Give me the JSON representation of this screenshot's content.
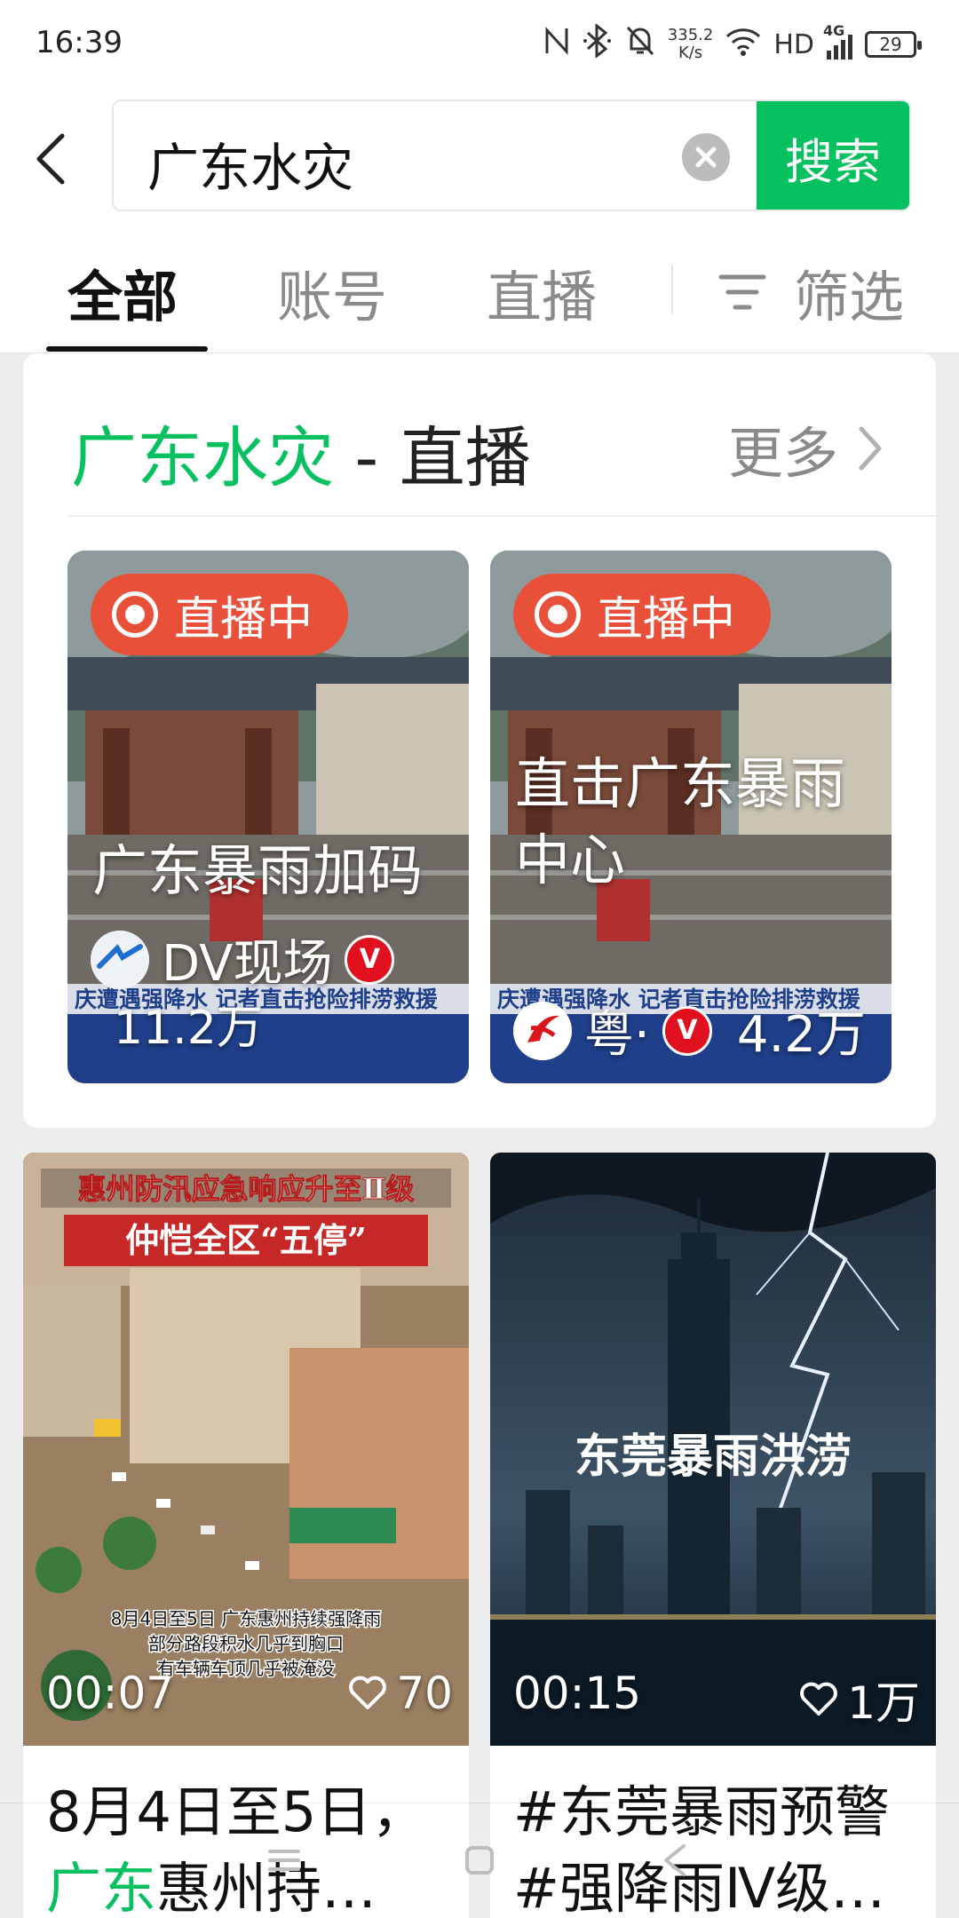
{
  "status_bar": {
    "time": "16:39",
    "speed_value": "335.2",
    "speed_unit": "K/s",
    "hd": "HD",
    "network": "4G",
    "battery": "29"
  },
  "search": {
    "query": "广东水灾",
    "button_label": "搜索"
  },
  "tabs": {
    "items": [
      "全部",
      "账号",
      "直播"
    ],
    "active": "全部",
    "filter_label": "筛选"
  },
  "live_section": {
    "keyword": "广东水灾",
    "suffix": " - 直播",
    "more_label": "更多",
    "items": [
      {
        "badge": "直播中",
        "title": "广东暴雨加码",
        "author": "DV现场",
        "verified": "V",
        "views": "11.2万",
        "caption": "庆遭遇强降水 记者直击抢险排涝救援"
      },
      {
        "badge": "直播中",
        "title": "直击广东暴雨中心",
        "author": "粤·",
        "verified": "V",
        "views": "4.2万",
        "caption": "庆遭遇强降水 记者直击抢险排涝救援"
      }
    ]
  },
  "videos": [
    {
      "overlay_top": "惠州防汛应急响应升至Ⅱ级",
      "overlay_banner": "仲恺全区“五停”",
      "overlay_bottom_1": "8月4日至5日 广东惠州持续强降雨",
      "overlay_bottom_2": "部分路段积水几乎到胸口",
      "overlay_bottom_3": "有车辆车顶几乎被淹没",
      "duration": "00:07",
      "likes": "70",
      "text_line1": "8月4日至5日，",
      "text_kw": "广东",
      "text_line2_rest": "惠州持…"
    },
    {
      "overlay_title": "东莞暴雨洪涝",
      "duration": "00:15",
      "likes": "1万",
      "text_line1": "#东莞暴雨预警",
      "text_line2": "#强降雨Ⅳ级…"
    }
  ],
  "colors": {
    "accent": "#07c160",
    "live_badge": "#e8503a",
    "verified": "#e0101e"
  }
}
